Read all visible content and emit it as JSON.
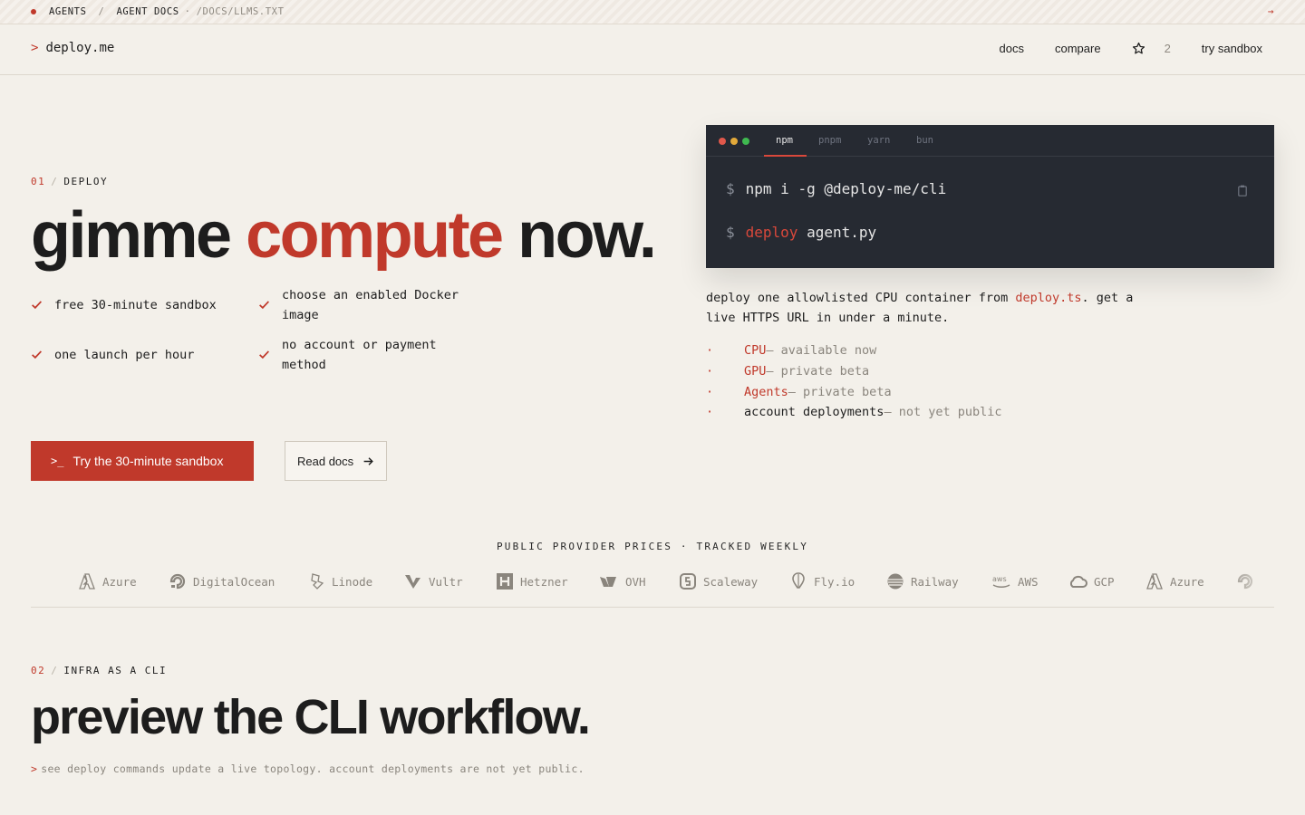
{
  "banner": {
    "crumb1": "AGENTS",
    "sep": "/",
    "crumb2": "AGENT DOCS",
    "dot_sep": "·",
    "path": "/DOCS/LLMS.TXT",
    "arrow": "→"
  },
  "nav": {
    "caret": ">",
    "brand": "deploy.me",
    "links": {
      "docs": "docs",
      "compare": "compare",
      "star_count": "2",
      "sandbox": "try sandbox"
    }
  },
  "hero": {
    "label": {
      "num": "01",
      "slash": "/",
      "text": "DEPLOY"
    },
    "title": {
      "part1": "gimme ",
      "accent": "compute",
      "part2": " now."
    },
    "features": [
      "free 30-minute sandbox",
      "choose an enabled Docker image",
      "one launch per hour",
      "no account or payment method"
    ],
    "primary_button": "Try the 30-minute sandbox",
    "primary_prompt": ">_",
    "secondary_button": "Read docs"
  },
  "terminal": {
    "tabs": [
      "npm",
      "pnpm",
      "yarn",
      "bun"
    ],
    "active_tab": "npm",
    "prompt": "$",
    "line1": "npm i -g @deploy-me/cli",
    "line2_cmd": "deploy",
    "line2_arg": "agent.py"
  },
  "description": {
    "pre": "deploy one allowlisted CPU container from ",
    "link": "deploy.ts",
    "post": ". get a live HTTPS URL in under a minute."
  },
  "status": [
    {
      "bullet": "·",
      "name": "CPU",
      "rest": " — available now"
    },
    {
      "bullet": "·",
      "name": "GPU",
      "rest": " — private beta"
    },
    {
      "bullet": "·",
      "name": "Agents",
      "rest": " — private beta"
    },
    {
      "bullet": "·",
      "name": "account deployments",
      "rest": " — not yet public"
    }
  ],
  "providers": {
    "label": "PUBLIC PROVIDER PRICES · TRACKED WEEKLY",
    "items": [
      "Azure",
      "DigitalOcean",
      "Linode",
      "Vultr",
      "Hetzner",
      "OVH",
      "Scaleway",
      "Fly.io",
      "Railway",
      "AWS",
      "GCP",
      "Azure"
    ]
  },
  "section2": {
    "label": {
      "num": "02",
      "slash": "/",
      "text": "INFRA AS A CLI"
    },
    "title": "preview the CLI workflow.",
    "caret": ">",
    "subtitle": "see deploy commands update a live topology. account deployments are not yet public."
  },
  "colors": {
    "accent": "#c0392b",
    "background": "#f3f0ea",
    "terminal": "#262a32"
  }
}
